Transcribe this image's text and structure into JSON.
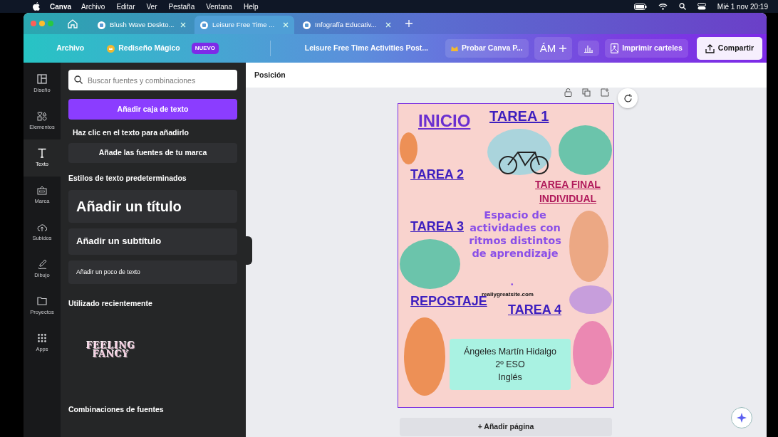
{
  "menubar": {
    "app": "Canva",
    "items": [
      "Archivo",
      "Editar",
      "Ver",
      "Pestaña",
      "Ventana",
      "Help"
    ],
    "clock": "Mié 1 nov 20:19"
  },
  "tabs": [
    {
      "label": "Blush Wave Deskto...",
      "selected": false
    },
    {
      "label": "Leisure Free Time ...",
      "selected": true
    },
    {
      "label": "Infografía Educativ...",
      "selected": false
    }
  ],
  "toolbar": {
    "file_menu": "Archivo",
    "magic": "Rediseño Mágico",
    "magic_badge": "NUEVO",
    "doc_title": "Leisure Free Time Activities Post...",
    "try_pro": "Probar Canva P...",
    "initials": "ÁM",
    "print": "Imprimir carteles",
    "share": "Compartir"
  },
  "sidebar": {
    "items": [
      {
        "label": "Diseño",
        "selected": false
      },
      {
        "label": "Elementos",
        "selected": false
      },
      {
        "label": "Texto",
        "selected": true
      },
      {
        "label": "Marca",
        "selected": false
      },
      {
        "label": "Subidos",
        "selected": false
      },
      {
        "label": "Dibujo",
        "selected": false
      },
      {
        "label": "Proyectos",
        "selected": false
      },
      {
        "label": "Apps",
        "selected": false
      }
    ]
  },
  "panel": {
    "search": {
      "placeholder": "Buscar fuentes y combinaciones"
    },
    "add_button": "Añadir caja de texto",
    "hint": "Haz clic en el texto para añadirlo",
    "brand_fonts": "Añade las fuentes de tu marca",
    "styles_title": "Estilos de texto predeterminados",
    "styles": [
      {
        "kind": "title",
        "text": "Añadir un título"
      },
      {
        "kind": "subtitle",
        "text": "Añadir un subtítulo"
      },
      {
        "kind": "body",
        "text": "Añadir un poco de texto"
      }
    ],
    "recent_title": "Utilizado recientemente",
    "recent_sample": "FEELING FANCY",
    "combos_title": "Combinaciones de fuentes"
  },
  "canvas": {
    "position": "Posición",
    "add_page": "+ Añadir página",
    "poster": {
      "labels": [
        {
          "text": "INICIO",
          "color": "#6a2fd0"
        },
        {
          "text": "TAREA 1",
          "color": "#3d1fbf"
        },
        {
          "text": "TAREA 2",
          "color": "#3d1fbf"
        },
        {
          "text": "TAREA FINAL INDIVIDUAL",
          "color": "#b0195a"
        },
        {
          "text": "TAREA 3",
          "color": "#3d1fbf"
        },
        {
          "text": "REPOSTAJE",
          "color": "#3d1fbf"
        },
        {
          "text": "TAREA 4",
          "color": "#3d1fbf"
        }
      ],
      "title": "Espacio de actividades con ritmos distintos de aprendizaje",
      "dot": "•",
      "website": "reallygreatsite.com",
      "author": [
        "Ángeles Martín Hidalgo",
        "2º ESO",
        "Inglés"
      ]
    }
  }
}
